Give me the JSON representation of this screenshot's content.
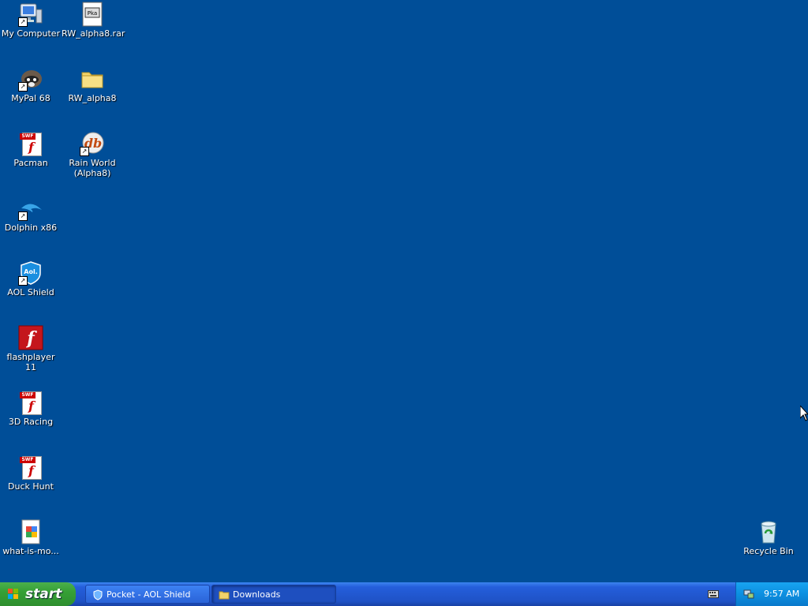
{
  "desktop": {
    "icons": [
      {
        "label": "My Computer",
        "icon": "my-computer-icon"
      },
      {
        "label": "RW_alpha8.rar",
        "icon": "rar-file-icon"
      },
      {
        "label": "MyPal 68",
        "icon": "mypal-icon"
      },
      {
        "label": "RW_alpha8",
        "icon": "folder-icon"
      },
      {
        "label": "Pacman",
        "icon": "swf-file-icon"
      },
      {
        "label": "Rain World (Alpha8)",
        "icon": "rain-world-icon"
      },
      {
        "label": "Dolphin x86",
        "icon": "dolphin-icon"
      },
      {
        "label": "AOL Shield",
        "icon": "aol-shield-icon"
      },
      {
        "label": "flashplayer 11",
        "icon": "flash-player-icon"
      },
      {
        "label": "3D Racing",
        "icon": "swf-file-icon"
      },
      {
        "label": "Duck Hunt",
        "icon": "swf-file-icon"
      },
      {
        "label": "what-is-mo...",
        "icon": "image-file-icon"
      },
      {
        "label": "Recycle Bin",
        "icon": "recycle-bin-icon"
      }
    ],
    "glyphs": {
      "rar_tag": "Pka",
      "swf_tag": "SWF",
      "aol_badge": "Aol.",
      "flash_letter": "f",
      "rain_world_badge": "db"
    }
  },
  "taskbar": {
    "start_label": "start",
    "tasks": [
      {
        "label": "Pocket - AOL Shield",
        "active": false
      },
      {
        "label": "Downloads",
        "active": true
      }
    ],
    "clock": "9:57 AM"
  },
  "colors": {
    "desktop": "#004e98",
    "taskbar": "#245edb",
    "start_button": "#35a035",
    "tray": "#0c8fe0"
  }
}
